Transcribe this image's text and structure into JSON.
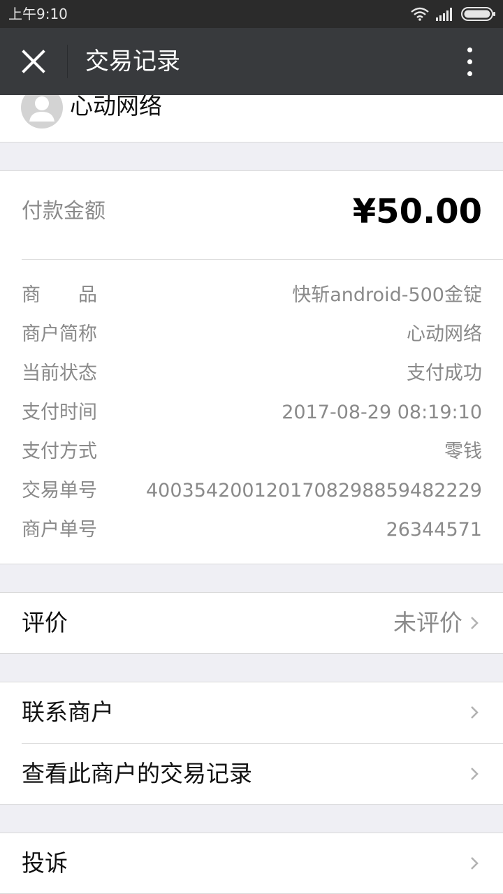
{
  "status_bar": {
    "time": "上午9:10"
  },
  "app_bar": {
    "title": "交易记录"
  },
  "merchant": {
    "name": "心动网络"
  },
  "payment": {
    "amount_label": "付款金额",
    "amount": "¥50.00",
    "details": [
      {
        "key": "商品",
        "value": "快斩android-500金锭"
      },
      {
        "key": "商户简称",
        "value": "心动网络"
      },
      {
        "key": "当前状态",
        "value": "支付成功"
      },
      {
        "key": "支付时间",
        "value": "2017-08-29 08:19:10"
      },
      {
        "key": "支付方式",
        "value": "零钱"
      },
      {
        "key": "交易单号",
        "value": "4003542001201708298859482229"
      },
      {
        "key": "商户单号",
        "value": "26344571"
      }
    ]
  },
  "review": {
    "label": "评价",
    "value": "未评价"
  },
  "actions": {
    "contact_merchant": "联系商户",
    "view_merchant_records": "查看此商户的交易记录",
    "complaint": "投诉"
  }
}
